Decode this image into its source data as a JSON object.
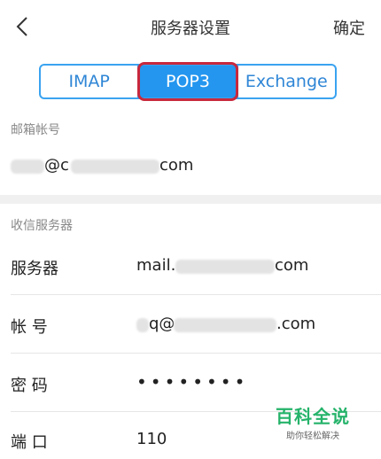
{
  "header": {
    "title": "服务器设置",
    "confirm": "确定",
    "back_icon": "chevron-left-icon"
  },
  "tabs": [
    {
      "label": "IMAP",
      "active": false
    },
    {
      "label": "POP3",
      "active": true
    },
    {
      "label": "Exchange",
      "active": false
    }
  ],
  "account": {
    "section_label": "邮箱帐号",
    "email_prefix": "@c",
    "email_suffix": "com"
  },
  "incoming": {
    "section_label": "收信服务器",
    "server_label": "服务器",
    "server_value_prefix": "mail.",
    "server_value_suffix": "com",
    "account_label": "帐 号",
    "account_value_prefix": "q@",
    "account_value_suffix": ".com",
    "password_label": "密 码",
    "password_value": "••••••••",
    "port_label": "端 口",
    "port_value": "110"
  },
  "watermark": {
    "main": "百科全说",
    "sub": "助你轻松解决"
  },
  "colors": {
    "accent": "#2496ef",
    "highlight": "#c8283d",
    "watermark": "#25b36a"
  }
}
